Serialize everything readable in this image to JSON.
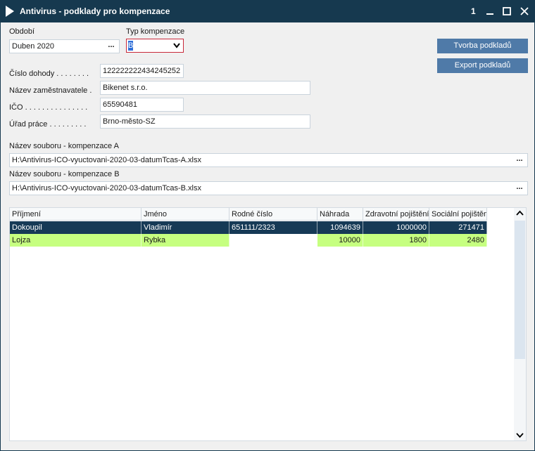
{
  "window": {
    "title": "Antivirus - podklady pro kompenzace",
    "counter": "1",
    "brand_color": "#16394f"
  },
  "form": {
    "obdobi_label": "Období",
    "obdobi_value": "Duben 2020",
    "typ_label": "Typ kompenzace",
    "typ_value": "B",
    "cislo_dohody_label": "Číslo dohody . . . . . . . .",
    "cislo_dohody_value": "122222222434245252",
    "nazev_zam_label": "Název zaměstnavatele .",
    "nazev_zam_value": "Bikenet s.r.o.",
    "ico_label": "IČO . . . . . . . . . . . . . . .",
    "ico_value": "65590481",
    "urad_label": "Úřad práce . . . . . . . . .",
    "urad_value": "Brno-město-SZ",
    "soubor_a_label": "Název souboru - kompenzace A",
    "soubor_a_value": "H:\\Antivirus-ICO-vyuctovani-2020-03-datumTcas-A.xlsx",
    "soubor_b_label": "Název souboru - kompenzace B",
    "soubor_b_value": "H:\\Antivirus-ICO-vyuctovani-2020-03-datumTcas-B.xlsx",
    "ellipsis": "..."
  },
  "buttons": {
    "tvorba": "Tvorba podkladů",
    "export": "Export podkladů",
    "color": "#4f7aa8"
  },
  "grid": {
    "columns": [
      "Příjmení",
      "Jméno",
      "Rodné číslo",
      "Náhrada",
      "Zdravotní pojištění",
      "Sociální pojištění"
    ],
    "rows": [
      [
        "Dokoupil",
        "Vladimír",
        "651111/2323",
        "1094639",
        "1000000",
        "271471"
      ],
      [
        "Lojza",
        "Rybka",
        "",
        "10000",
        "1800",
        "2480"
      ]
    ],
    "selected_color": "#163a56",
    "highlight_color": "#c6ff80"
  }
}
